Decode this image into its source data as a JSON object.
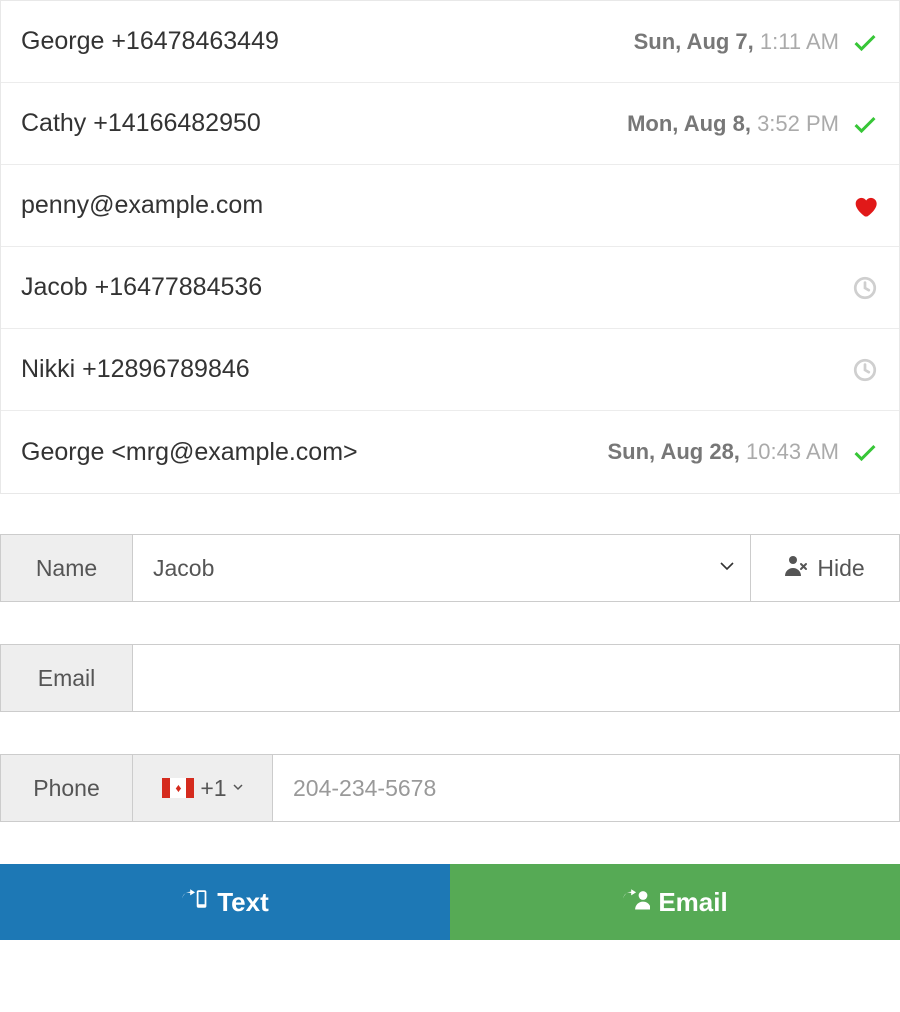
{
  "contacts": [
    {
      "label": "George +16478463449",
      "date_prefix": "Sun, Aug 7,",
      "date_time": "1:11 AM",
      "status": "check"
    },
    {
      "label": "Cathy +14166482950",
      "date_prefix": "Mon, Aug 8,",
      "date_time": "3:52 PM",
      "status": "check"
    },
    {
      "label": "penny@example.com",
      "date_prefix": "",
      "date_time": "",
      "status": "heart"
    },
    {
      "label": "Jacob +16477884536",
      "date_prefix": "",
      "date_time": "",
      "status": "clock"
    },
    {
      "label": "Nikki +12896789846",
      "date_prefix": "",
      "date_time": "",
      "status": "clock"
    },
    {
      "label": "George <mrg@example.com>",
      "date_prefix": "Sun, Aug 28,",
      "date_time": "10:43 AM",
      "status": "check"
    }
  ],
  "form": {
    "name_label": "Name",
    "name_value": "Jacob",
    "hide_label": "Hide",
    "email_label": "Email",
    "email_value": "",
    "phone_label": "Phone",
    "phone_country_code": "+1",
    "phone_placeholder": "204-234-5678",
    "phone_value": ""
  },
  "actions": {
    "text_label": "Text",
    "email_label": "Email"
  }
}
